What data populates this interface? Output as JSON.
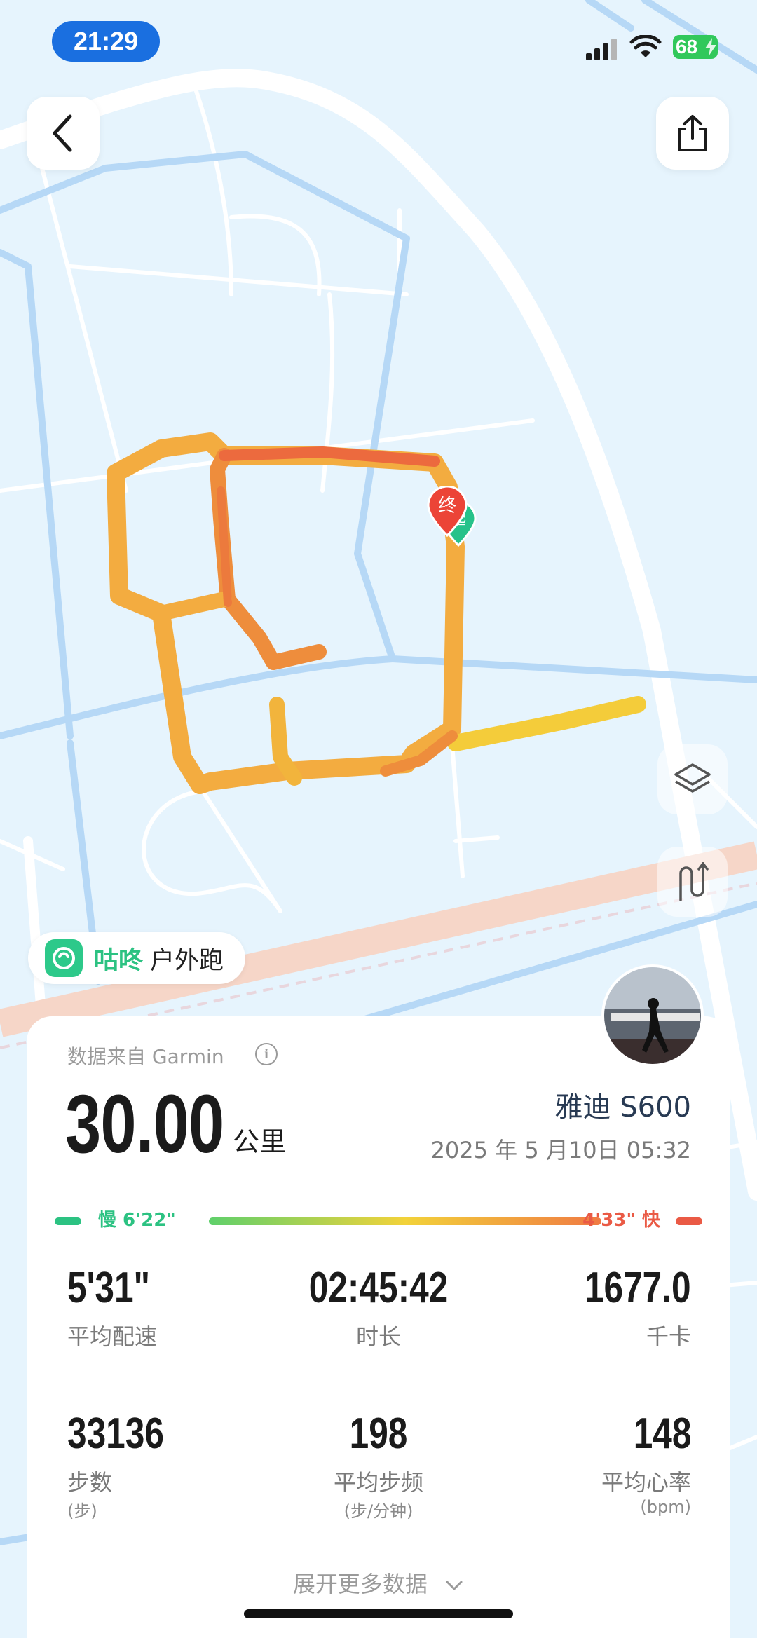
{
  "status": {
    "time": "21:29",
    "battery": "68"
  },
  "map": {
    "start_marker": "起",
    "end_marker": "终"
  },
  "icons": {
    "back": "chevron-left-icon",
    "share": "share-icon",
    "layers": "layers-icon",
    "route_mode": "route-icon"
  },
  "brand": {
    "name": "咕咚",
    "type": "户外跑"
  },
  "card": {
    "source": "数据来自 Garmin",
    "distance": "30.00",
    "distance_unit": "公里",
    "shoe": "雅迪 S600",
    "datetime": "2025 年 5 月10日 05:32",
    "pace_slow": "慢 6'22\"",
    "pace_fast": "4'33\" 快",
    "stats": [
      {
        "value": "5'31\"",
        "label": "平均配速",
        "sub": ""
      },
      {
        "value": "02:45:42",
        "label": "时长",
        "sub": ""
      },
      {
        "value": "1677.0",
        "label": "千卡",
        "sub": ""
      },
      {
        "value": "33136",
        "label": "步数",
        "sub": "(步)"
      },
      {
        "value": "198",
        "label": "平均步频",
        "sub": "(步/分钟)"
      },
      {
        "value": "148",
        "label": "平均心率",
        "sub": "(bpm)"
      }
    ],
    "more": "展开更多数据"
  },
  "colors": {
    "accent_green": "#2cc282",
    "accent_red": "#ea5a45",
    "status_blue": "#1a6fe0",
    "route_orange": "#f0a83a"
  }
}
